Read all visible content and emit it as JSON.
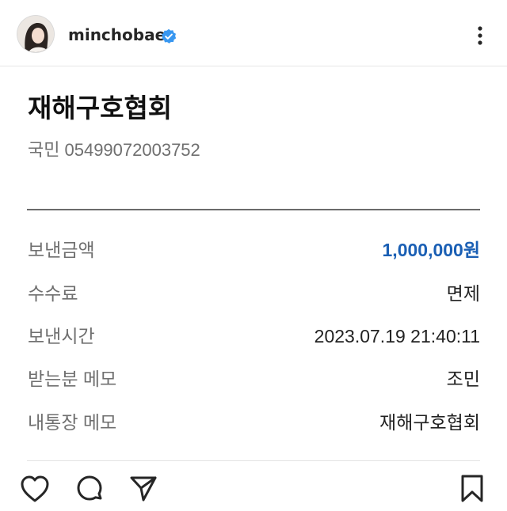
{
  "post": {
    "username": "minchobae",
    "verified": true,
    "avatar_icon": "profile-photo",
    "more_icon": "more-vertical-icon"
  },
  "receipt": {
    "recipient_name": "재해구호협회",
    "bank": "국민",
    "account_number": "05499072003752",
    "rows": [
      {
        "label": "보낸금액",
        "value": "1,000,000원"
      },
      {
        "label": "수수료",
        "value": "면제"
      },
      {
        "label": "보낸시간",
        "value": "2023.07.19 21:40:11"
      },
      {
        "label": "받는분 메모",
        "value": "조민"
      },
      {
        "label": "내통장 메모",
        "value": "재해구호협회"
      }
    ]
  },
  "actions": {
    "like_icon": "heart-icon",
    "comment_icon": "comment-icon",
    "share_icon": "paper-plane-icon",
    "save_icon": "bookmark-icon"
  },
  "colors": {
    "amount": "#1a5fb4",
    "verified_badge": "#3897f0",
    "label_gray": "#6f6f6f",
    "text_dark": "#111111"
  }
}
